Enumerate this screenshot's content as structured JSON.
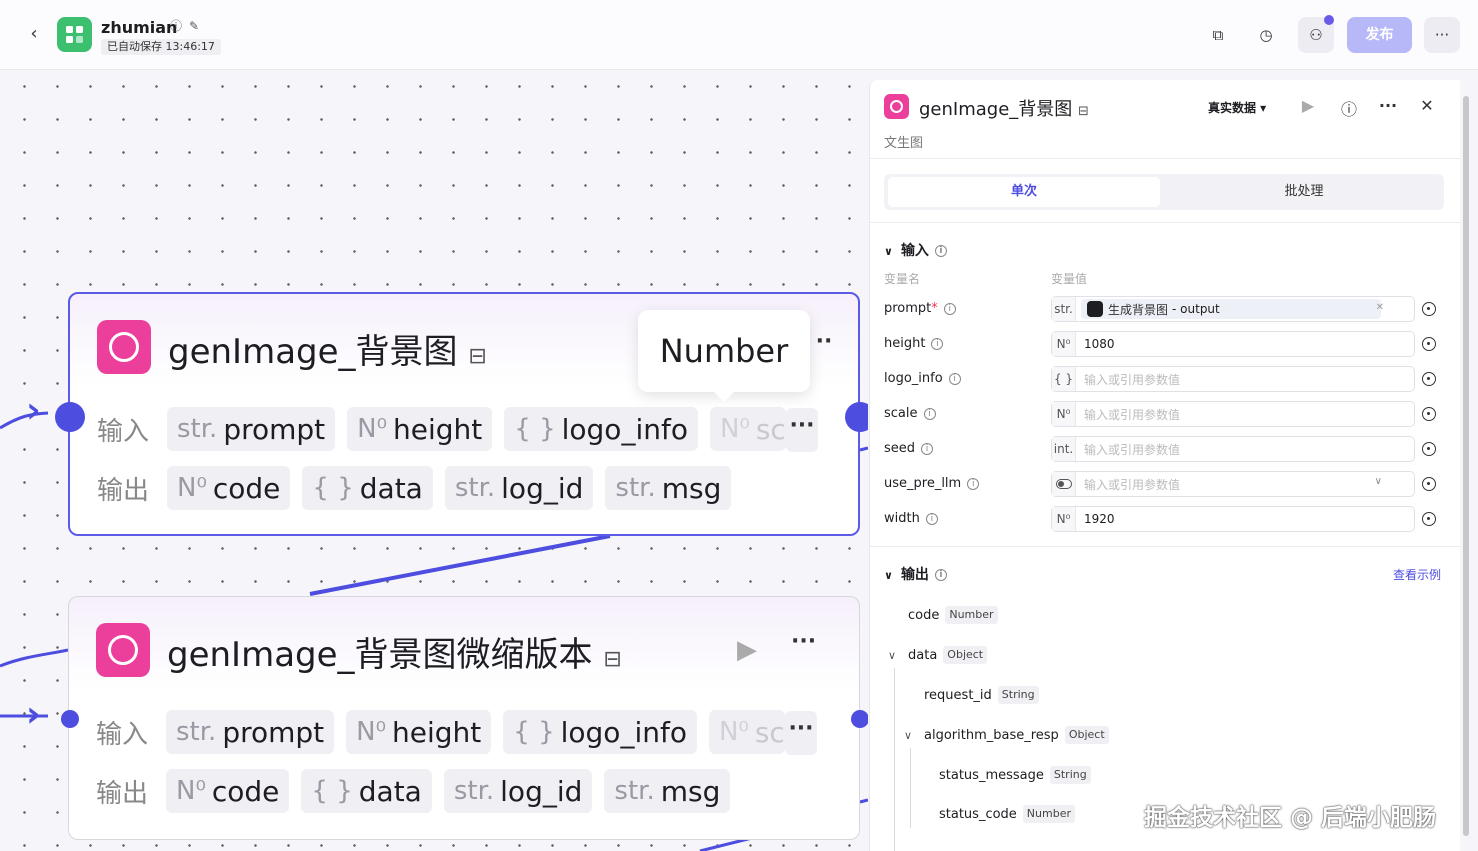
{
  "header": {
    "back": "‹",
    "app_name": "zhumian",
    "autosave": "已自动保存 13:46:17",
    "publish": "发布"
  },
  "canvas": {
    "tooltip": "Number",
    "nodes": [
      {
        "title": "genImage_背景图",
        "input_label": "输入",
        "output_label": "输出",
        "inputs": [
          {
            "type": "str.",
            "name": "prompt"
          },
          {
            "type": "N⁰",
            "name": "height"
          },
          {
            "type": "{ }",
            "name": "logo_info"
          },
          {
            "type": "N⁰",
            "name": "sc"
          }
        ],
        "outputs": [
          {
            "type": "N⁰",
            "name": "code"
          },
          {
            "type": "{ }",
            "name": "data"
          },
          {
            "type": "str.",
            "name": "log_id"
          },
          {
            "type": "str.",
            "name": "msg"
          }
        ]
      },
      {
        "title": "genImage_背景图微缩版本",
        "input_label": "输入",
        "output_label": "输出",
        "inputs": [
          {
            "type": "str.",
            "name": "prompt"
          },
          {
            "type": "N⁰",
            "name": "height"
          },
          {
            "type": "{ }",
            "name": "logo_info"
          },
          {
            "type": "N⁰",
            "name": "sc"
          }
        ],
        "outputs": [
          {
            "type": "N⁰",
            "name": "code"
          },
          {
            "type": "{ }",
            "name": "data"
          },
          {
            "type": "str.",
            "name": "log_id"
          },
          {
            "type": "str.",
            "name": "msg"
          }
        ]
      }
    ]
  },
  "panel": {
    "title": "genImage_背景图",
    "subtitle": "文生图",
    "real_data": "真实数据 ▾",
    "tabs": [
      "单次",
      "批处理"
    ],
    "input_section": "输入",
    "col_name": "变量名",
    "col_value": "变量值",
    "inputs": [
      {
        "name": "prompt",
        "required": "*",
        "type": "str.",
        "ref_node": "生成背景图",
        "ref_field": "- output"
      },
      {
        "name": "height",
        "type": "N⁰",
        "value": "1080"
      },
      {
        "name": "logo_info",
        "type": "{ }",
        "placeholder": "输入或引用参数值"
      },
      {
        "name": "scale",
        "type": "N⁰",
        "placeholder": "输入或引用参数值"
      },
      {
        "name": "seed",
        "type": "int.",
        "placeholder": "输入或引用参数值"
      },
      {
        "name": "use_pre_llm",
        "type": "toggle",
        "placeholder": "输入或引用参数值"
      },
      {
        "name": "width",
        "type": "N⁰",
        "value": "1920"
      }
    ],
    "output_section": "输出",
    "view_example": "查看示例",
    "outputs": [
      {
        "name": "code",
        "type": "Number"
      },
      {
        "name": "data",
        "type": "Object"
      },
      {
        "name": "request_id",
        "type": "String"
      },
      {
        "name": "algorithm_base_resp",
        "type": "Object"
      },
      {
        "name": "status_message",
        "type": "String"
      },
      {
        "name": "status_code",
        "type": "Number"
      }
    ]
  },
  "watermark": "掘金技术社区 @ 后端小肥肠"
}
